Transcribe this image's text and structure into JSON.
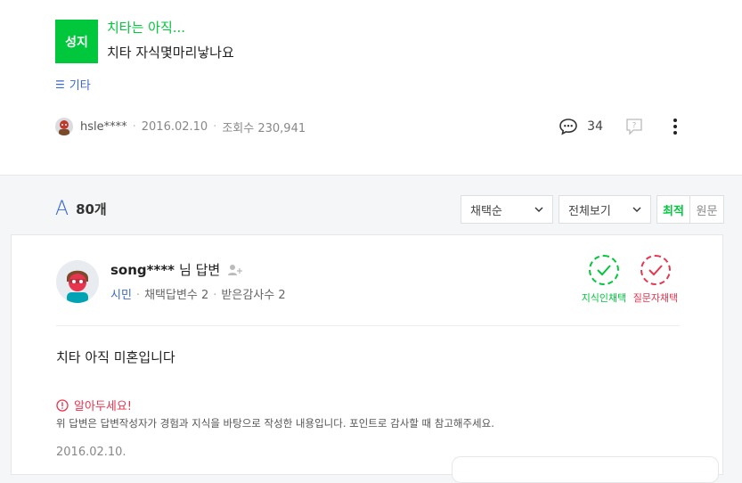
{
  "question": {
    "badge": "성지",
    "title_link": "치타는 아직...",
    "title": "치타 자식몇마리낳나요",
    "category_icon": "☰",
    "category": "기타",
    "author": "hsle****",
    "date": "2016.02.10",
    "views": "조회수 230,941",
    "comment_count": "34"
  },
  "answers": {
    "icon": "A",
    "count": "80개",
    "sort_label": "채택순",
    "filter_label": "전체보기",
    "toggle_latest": "최적",
    "toggle_original": "원문"
  },
  "answer": {
    "name": "song****",
    "suffix": "님 답변",
    "rank": "시민",
    "adopted": "채택답변수 2",
    "thanks": "받은감사수 2",
    "choose_knowin_label": "지식인채택",
    "choose_asker_label": "질문자채택",
    "body": "치타 아직 미혼입니다",
    "notice_title": "알아두세요!",
    "notice_text": "위 답변은 답변작성자가 경험과 지식을 바탕으로 작성한 내용입니다. 포인트로 감사할 때 참고해주세요.",
    "date": "2016.02.10."
  },
  "colors": {
    "green": "#00c73c",
    "red": "#e8354f",
    "blue": "#3867d6"
  }
}
